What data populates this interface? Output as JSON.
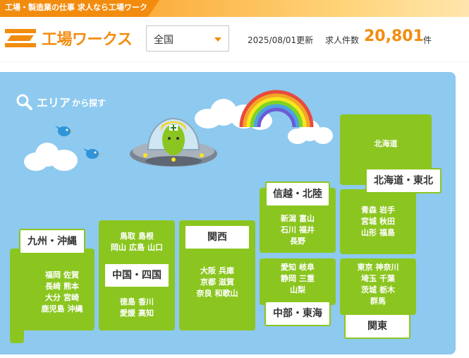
{
  "topbar": {
    "tagline": "工場・製造業の仕事 求人なら工場ワークス"
  },
  "header": {
    "logo_text": "工場ワークス",
    "area_select": {
      "value": "全国"
    },
    "updated": "2025/08/01更新",
    "count_label": "求人件数",
    "count": "20,801",
    "count_unit": "件"
  },
  "map": {
    "title_main": "エリア",
    "title_sub": "から探す",
    "regions": {
      "hokkaido_tohoku": {
        "label": "北海道・東北",
        "hokkaido": "北海道",
        "rows": [
          [
            "青森",
            "岩手"
          ],
          [
            "宮城",
            "秋田"
          ],
          [
            "山形",
            "福島"
          ]
        ]
      },
      "shinetsu_hokuriku": {
        "label": "信越・北陸",
        "rows": [
          [
            "新潟",
            "富山"
          ],
          [
            "石川",
            "福井"
          ],
          [
            "長野"
          ]
        ]
      },
      "kanto": {
        "label": "関東",
        "rows": [
          [
            "東京",
            "神奈川"
          ],
          [
            "埼玉",
            "千葉"
          ],
          [
            "茨城",
            "栃木"
          ],
          [
            "群馬"
          ]
        ]
      },
      "chubu_tokai": {
        "label": "中部・東海",
        "rows": [
          [
            "愛知",
            "岐阜"
          ],
          [
            "静岡",
            "三重"
          ],
          [
            "山梨"
          ]
        ]
      },
      "kansai": {
        "label": "関西",
        "rows": [
          [
            "大阪",
            "兵庫"
          ],
          [
            "京都",
            "滋賀"
          ],
          [
            "奈良",
            "和歌山"
          ]
        ]
      },
      "chugoku_shikoku": {
        "label": "中国・四国",
        "rows_top": [
          [
            "鳥取",
            "島根"
          ],
          [
            "岡山",
            "広島",
            "山口"
          ]
        ],
        "rows_bottom": [
          [
            "徳島",
            "香川"
          ],
          [
            "愛媛",
            "高知"
          ]
        ]
      },
      "kyushu_okinawa": {
        "label": "九州・沖縄",
        "rows": [
          [
            "福岡",
            "佐賀"
          ],
          [
            "長崎",
            "熊本"
          ],
          [
            "大分",
            "宮崎"
          ],
          [
            "鹿児島",
            "沖縄"
          ]
        ]
      }
    }
  },
  "colors": {
    "accent": "#f28c0f",
    "map_bg": "#8ec9ef",
    "region_green": "#8bc620"
  }
}
